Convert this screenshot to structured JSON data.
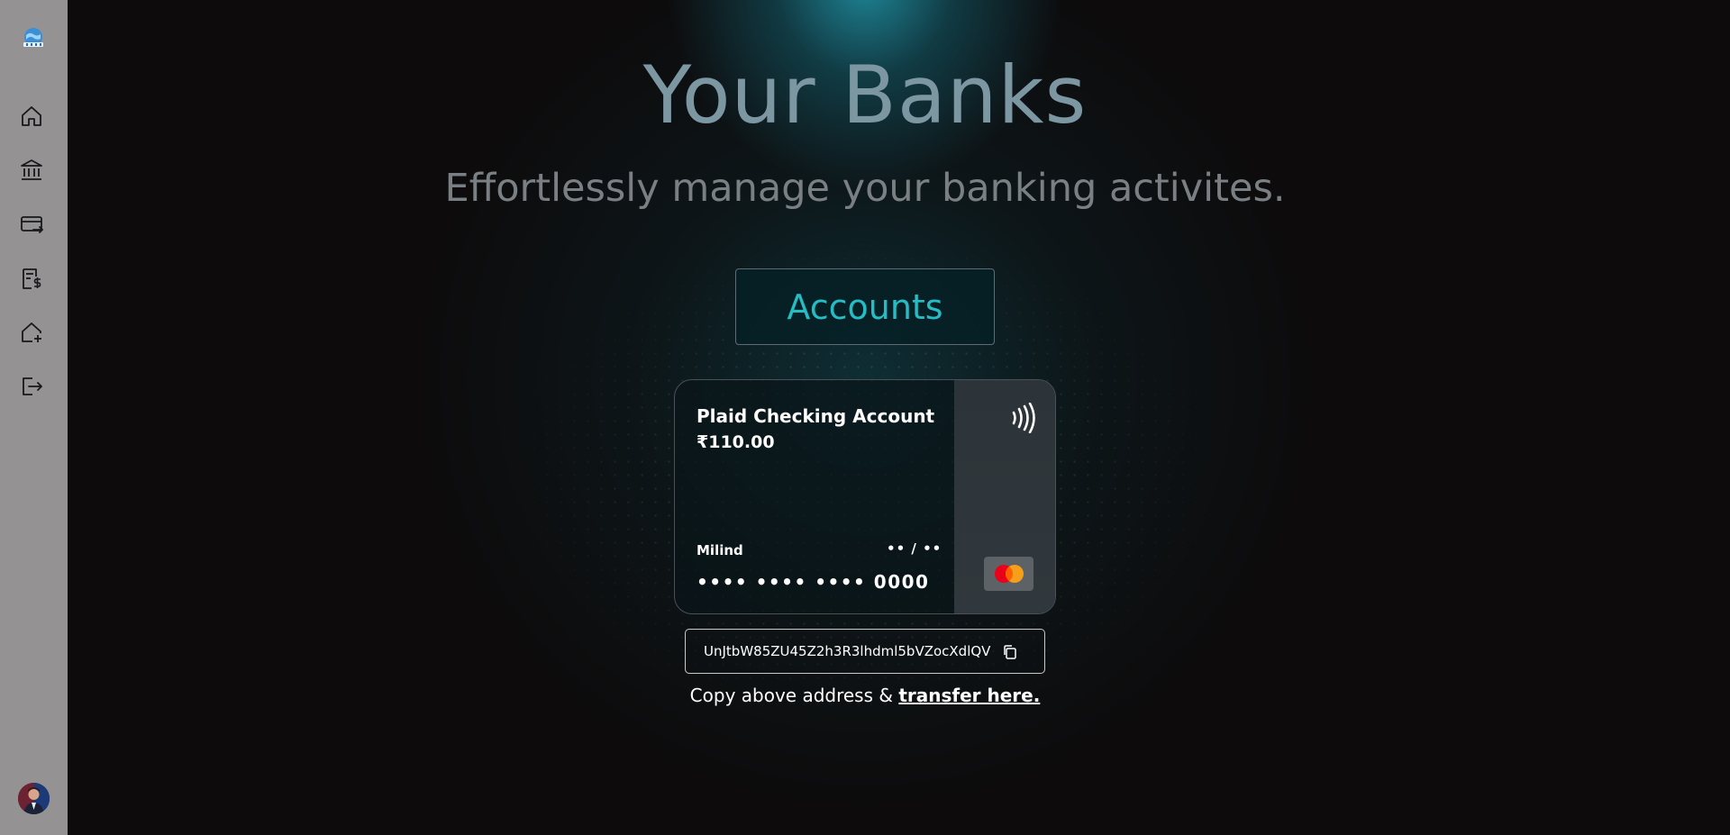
{
  "sidebar": {
    "logo": "globe-bank-logo",
    "items": [
      {
        "name": "home",
        "icon": "home-icon"
      },
      {
        "name": "my-banks",
        "icon": "bank-icon"
      },
      {
        "name": "transaction-history",
        "icon": "card-transfer-icon"
      },
      {
        "name": "payment-transfer",
        "icon": "receipt-dollar-icon"
      },
      {
        "name": "connect-bank",
        "icon": "home-plus-icon"
      },
      {
        "name": "logout",
        "icon": "logout-icon"
      }
    ],
    "avatar": "user-avatar"
  },
  "header": {
    "title": "Your Banks",
    "subtitle": "Effortlessly manage your banking activites."
  },
  "accounts_button": "Accounts",
  "card": {
    "name": "Plaid Checking Account",
    "balance": "₹110.00",
    "holder": "Milind",
    "expiry": "•• / ••",
    "number": "•••• •••• •••• 0000",
    "network": "mastercard"
  },
  "address": {
    "value": "UnJtbW85ZU45Z2h3R3lhdml5bVZocXdlQV",
    "note_prefix": "Copy above address & ",
    "note_link": "transfer here."
  },
  "colors": {
    "sidebar_bg": "#949293",
    "page_bg": "#0d0b0c",
    "accent": "#25bcc3",
    "title": "#7d97a2"
  }
}
